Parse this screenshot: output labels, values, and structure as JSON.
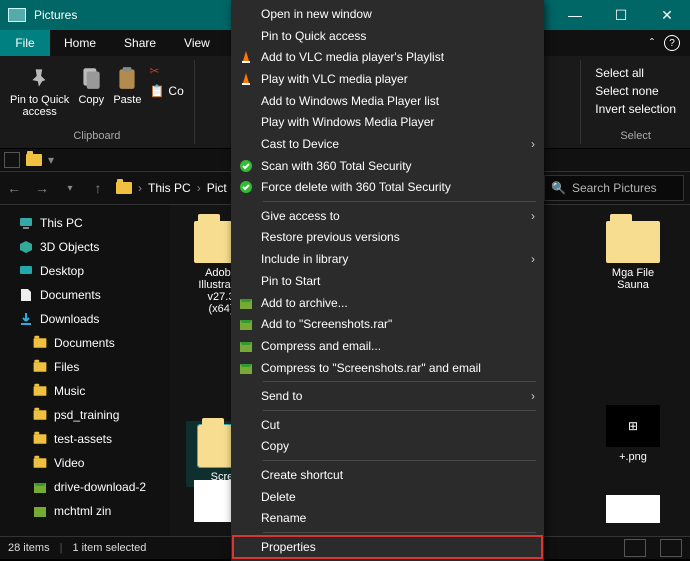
{
  "window": {
    "title": "Pictures"
  },
  "winbtns": {
    "min": "—",
    "max": "☐",
    "close": "✕"
  },
  "tabs": {
    "file": "File",
    "home": "Home",
    "share": "Share",
    "view": "View"
  },
  "ribbon": {
    "pin": "Pin to Quick\naccess",
    "copy": "Copy",
    "paste": "Paste",
    "copypath": "Co",
    "clipboard_group": "Clipboard",
    "select_all": "Select all",
    "select_none": "Select none",
    "invert_selection": "Invert selection",
    "select_group": "Select"
  },
  "breadcrumb": {
    "thispc": "This PC",
    "pictures": "Pict"
  },
  "search": {
    "placeholder": "Search Pictures"
  },
  "tree": {
    "thispc": "This PC",
    "objects3d": "3D Objects",
    "desktop": "Desktop",
    "documents": "Documents",
    "downloads": "Downloads",
    "sub_documents": "Documents",
    "sub_files": "Files",
    "sub_music": "Music",
    "sub_psd": "psd_training",
    "sub_test": "test-assets",
    "sub_video": "Video",
    "sub_drive": "drive-download-2",
    "sub_mchtml": "mchtml zin"
  },
  "items": {
    "i1": "Adobe\nIllustrator\nv27.3\n(x64)",
    "i2_sel": "Scree",
    "i3": "Mga File\nSauna",
    "i4": "+.png"
  },
  "statusbar": {
    "items": "28 items",
    "selected": "1 item selected"
  },
  "ctx": {
    "open_new": "Open in new window",
    "pin_quick": "Pin to Quick access",
    "vlc_playlist": "Add to VLC media player's Playlist",
    "vlc_play": "Play with VLC media player",
    "wmp_list": "Add to Windows Media Player list",
    "wmp_play": "Play with Windows Media Player",
    "cast": "Cast to Device",
    "scan360": "Scan with 360 Total Security",
    "force360": "Force delete with 360 Total Security",
    "give_access": "Give access to",
    "restore": "Restore previous versions",
    "include_lib": "Include in library",
    "pin_start": "Pin to Start",
    "add_archive": "Add to archive...",
    "add_rar": "Add to \"Screenshots.rar\"",
    "compress_email": "Compress and email...",
    "compress_rar_email": "Compress to \"Screenshots.rar\" and email",
    "send_to": "Send to",
    "cut": "Cut",
    "copy": "Copy",
    "shortcut": "Create shortcut",
    "delete": "Delete",
    "rename": "Rename",
    "properties": "Properties"
  }
}
